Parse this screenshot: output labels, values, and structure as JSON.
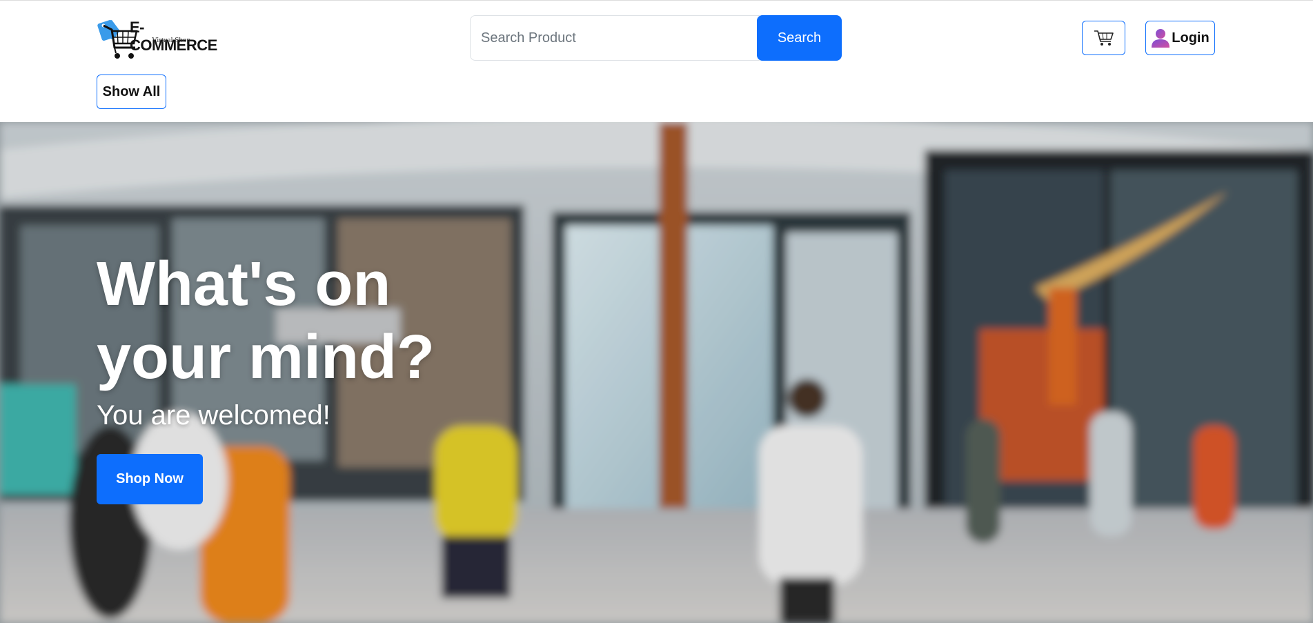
{
  "brand": {
    "name": "E-COMMERCE",
    "tagline": "Virtual Shop",
    "accent_color": "#3a9bea"
  },
  "search": {
    "placeholder": "Search Product",
    "value": "",
    "button_label": "Search"
  },
  "nav": {
    "cart_icon": "shopping-cart-icon",
    "login_icon": "user-icon",
    "login_label": "Login",
    "show_all_label": "Show All"
  },
  "hero": {
    "title": "What's on your mind?",
    "subtitle": "You are welcomed!",
    "cta_label": "Shop Now",
    "background_image": "blurred-shopping-mall-photo"
  },
  "colors": {
    "primary": "#0d6efd",
    "text": "#111111",
    "hero_text": "#ffffff"
  }
}
